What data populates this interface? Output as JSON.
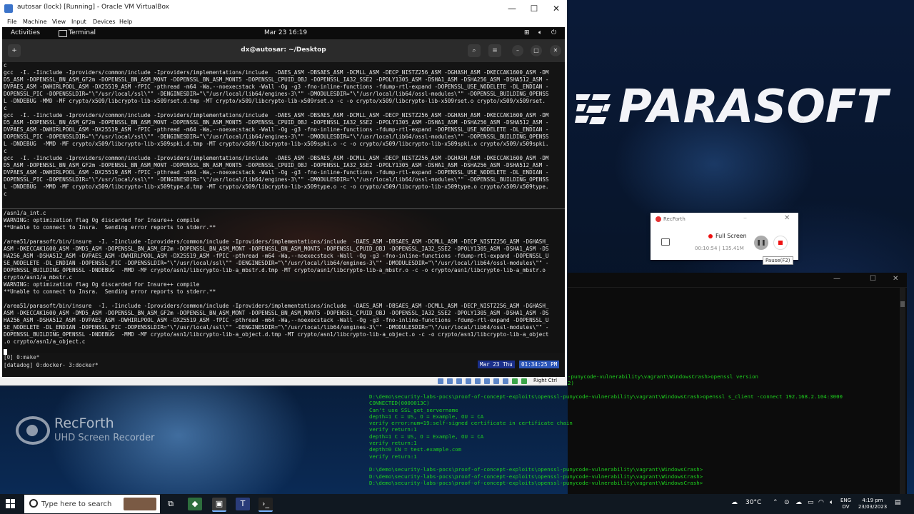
{
  "vbox": {
    "title": "autosar (lock) [Running] - Oracle VM VirtualBox",
    "menu": [
      "File",
      "Machine",
      "View",
      "Input",
      "Devices",
      "Help"
    ],
    "status_right": "Right Ctrl"
  },
  "gnome": {
    "activities": "Activities",
    "app": "Terminal",
    "clock": "Mar 23  16:19"
  },
  "terminal": {
    "title": "dx@autosar: ~/Desktop",
    "top_pane": "c\ngcc  -I. -Iinclude -Iproviders/common/include -Iproviders/implementations/include  -DAES_ASM -DBSAES_ASM -DCMLL_ASM -DECP_NISTZ256_ASM -DGHASH_ASM -DKECCAK1600_ASM -DM\nD5_ASM -DOPENSSL_BN_ASM_GF2m -DOPENSSL_BN_ASM_MONT -DOPENSSL_BN_ASM_MONT5 -DOPENSSL_CPUID_OBJ -DOPENSSL_IA32_SSE2 -DPOLY1305_ASM -DSHA1_ASM -DSHA256_ASM -DSHA512_ASM -\nDVPAES_ASM -DWHIRLPOOL_ASM -DX25519_ASM -fPIC -pthread -m64 -Wa,--noexecstack -Wall -Og -g3 -fno-inline-functions -fdump-rtl-expand -DOPENSSL_USE_NODELETE -DL_ENDIAN -\nDOPENSSL_PIC -DOPENSSLDIR=\"\\\"/usr/local/ssl\\\"\" -DENGINESDIR=\"\\\"/usr/local/lib64/engines-3\\\"\" -DMODULESDIR=\"\\\"/usr/local/lib64/ossl-modules\\\"\" -DOPENSSL_BUILDING_OPENSS\nL -DNDEBUG -MMD -MF crypto/x509/libcrypto-lib-x509rset.d.tmp -MT crypto/x509/libcrypto-lib-x509rset.o -c -o crypto/x509/libcrypto-lib-x509rset.o crypto/x509/x509rset.\nc\ngcc  -I. -Iinclude -Iproviders/common/include -Iproviders/implementations/include  -DAES_ASM -DBSAES_ASM -DCMLL_ASM -DECP_NISTZ256_ASM -DGHASH_ASM -DKECCAK1600_ASM -DM\nD5_ASM -DOPENSSL_BN_ASM_GF2m -DOPENSSL_BN_ASM_MONT -DOPENSSL_BN_ASM_MONT5 -DOPENSSL_CPUID_OBJ -DOPENSSL_IA32_SSE2 -DPOLY1305_ASM -DSHA1_ASM -DSHA256_ASM -DSHA512_ASM -\nDVPAES_ASM -DWHIRLPOOL_ASM -DX25519_ASM -fPIC -pthread -m64 -Wa,--noexecstack -Wall -Og -g3 -fno-inline-functions -fdump-rtl-expand -DOPENSSL_USE_NODELETE -DL_ENDIAN -\nDOPENSSL_PIC -DOPENSSLDIR=\"\\\"/usr/local/ssl\\\"\" -DENGINESDIR=\"\\\"/usr/local/lib64/engines-3\\\"\" -DMODULESDIR=\"\\\"/usr/local/lib64/ossl-modules\\\"\" -DOPENSSL_BUILDING_OPENSS\nL -DNDEBUG  -MMD -MF crypto/x509/libcrypto-lib-x509spki.d.tmp -MT crypto/x509/libcrypto-lib-x509spki.o -c -o crypto/x509/libcrypto-lib-x509spki.o crypto/x509/x509spki.\nc\ngcc  -I. -Iinclude -Iproviders/common/include -Iproviders/implementations/include  -DAES_ASM -DBSAES_ASM -DCMLL_ASM -DECP_NISTZ256_ASM -DGHASH_ASM -DKECCAK1600_ASM -DM\nD5_ASM -DOPENSSL_BN_ASM_GF2m -DOPENSSL_BN_ASM_MONT -DOPENSSL_BN_ASM_MONT5 -DOPENSSL_CPUID_OBJ -DOPENSSL_IA32_SSE2 -DPOLY1305_ASM -DSHA1_ASM -DSHA256_ASM -DSHA512_ASM -\nDVPAES_ASM -DWHIRLPOOL_ASM -DX25519_ASM -fPIC -pthread -m64 -Wa,--noexecstack -Wall -Og -g3 -fno-inline-functions -fdump-rtl-expand -DOPENSSL_USE_NODELETE -DL_ENDIAN -\nDOPENSSL_PIC -DOPENSSLDIR=\"\\\"/usr/local/ssl\\\"\" -DENGINESDIR=\"\\\"/usr/local/lib64/engines-3\\\"\" -DMODULESDIR=\"\\\"/usr/local/lib64/ossl-modules\\\"\" -DOPENSSL_BUILDING_OPENSS\nL -DNDEBUG  -MMD -MF crypto/x509/libcrypto-lib-x509type.d.tmp -MT crypto/x509/libcrypto-lib-x509type.o -c -o crypto/x509/libcrypto-lib-x509type.o crypto/x509/x509type.\nc",
    "bottom_pane": "/asn1/a_int.c\nWARNING: optimization flag Og discarded for Insure++ compile\n**Unable to connect to Insra.  Sending error reports to stderr.**\n\n/area51/parasoft/bin/insure  -I. -Iinclude -Iproviders/common/include -Iproviders/implementations/include  -DAES_ASM -DBSAES_ASM -DCMLL_ASM -DECP_NISTZ256_ASM -DGHASH_\nASM -DKECCAK1600_ASM -DMD5_ASM -DOPENSSL_BN_ASM_GF2m -DOPENSSL_BN_ASM_MONT -DOPENSSL_BN_ASM_MONT5 -DOPENSSL_CPUID_OBJ -DOPENSSL_IA32_SSE2 -DPOLY1305_ASM -DSHA1_ASM -DS\nHA256_ASM -DSHA512_ASM -DVPAES_ASM -DWHIRLPOOL_ASM -DX25519_ASM -fPIC -pthread -m64 -Wa,--noexecstack -Wall -Og -g3 -fno-inline-functions -fdump-rtl-expand -DOPENSSL_U\nSE_NODELETE -DL_ENDIAN -DOPENSSL_PIC -DOPENSSLDIR=\"\\\"/usr/local/ssl\\\"\" -DENGINESDIR=\"\\\"/usr/local/lib64/engines-3\\\"\" -DMODULESDIR=\"\\\"/usr/local/lib64/ossl-modules\\\"\" -\nDOPENSSL_BUILDING_OPENSSL -DNDEBUG  -MMD -MF crypto/asn1/libcrypto-lib-a_mbstr.d.tmp -MT crypto/asn1/libcrypto-lib-a_mbstr.o -c -o crypto/asn1/libcrypto-lib-a_mbstr.o \ncrypto/asn1/a_mbstr.c\nWARNING: optimization flag Og discarded for Insure++ compile\n**Unable to connect to Insra.  Sending error reports to stderr.**\n\n/area51/parasoft/bin/insure  -I. -Iinclude -Iproviders/common/include -Iproviders/implementations/include  -DAES_ASM -DBSAES_ASM -DCMLL_ASM -DECP_NISTZ256_ASM -DGHASH_\nASM -DKECCAK1600_ASM -DMD5_ASM -DOPENSSL_BN_ASM_GF2m -DOPENSSL_BN_ASM_MONT -DOPENSSL_BN_ASM_MONT5 -DOPENSSL_CPUID_OBJ -DOPENSSL_IA32_SSE2 -DPOLY1305_ASM -DSHA1_ASM -DS\nHA256_ASM -DSHA512_ASM -DVPAES_ASM -DWHIRLPOOL_ASM -DX25519_ASM -fPIC -pthread -m64 -Wa,--noexecstack -Wall -Og -g3 -fno-inline-functions -fdump-rtl-expand -DOPENSSL_U\nSE_NODELETE -DL_ENDIAN -DOPENSSL_PIC -DOPENSSLDIR=\"\\\"/usr/local/ssl\\\"\" -DENGINESDIR=\"\\\"/usr/local/lib64/engines-3\\\"\" -DMODULESDIR=\"\\\"/usr/local/lib64/ossl-modules\\\"\" -\nDOPENSSL_BUILDING_OPENSSL -DNDEBUG  -MMD -MF crypto/asn1/libcrypto-lib-a_object.d.tmp -MT crypto/asn1/libcrypto-lib-a_object.o -c -o crypto/asn1/libcrypto-lib-a_object\n.o crypto/asn1/a_object.c",
    "tmux_window": "[0] 0:make*",
    "tmux_session": "[datadog] 0:docker- 3:docker*",
    "tmux_date": "Mar 23 Thu",
    "tmux_time": "01:34:25 PM"
  },
  "brand": {
    "logo_text": "PARASOFT",
    "reg_mark": "®"
  },
  "recforth_widget": {
    "app_name": "RecForth",
    "mode": "Full Screen",
    "elapsed": "00:10:54",
    "size": "135.41M",
    "pause_tooltip": "Pause(F2)"
  },
  "watermark": {
    "title": "RecForth",
    "subtitle": "UHD Screen Recorder"
  },
  "cmd": {
    "partial_top": "-punycode-vulnerability\\vagrant\\WindowsCrash>openssl version\n2)",
    "output": "D:\\demo\\security-labs-pocs\\proof-of-concept-exploits\\openssl-punycode-vulnerability\\vagrant\\WindowsCrash>openssl s_client -connect 192.168.2.104:3000\nCONNECTED(0000013C)\nCan't use SSL_get_servername\ndepth=1 C = US, O = Example, OU = CA\nverify error:num=19:self-signed certificate in certificate chain\nverify return:1\ndepth=1 C = US, O = Example, OU = CA\nverify return:1\ndepth=0 CN = test.example.com\nverify return:1\n\nD:\\demo\\security-labs-pocs\\proof-of-concept-exploits\\openssl-punycode-vulnerability\\vagrant\\WindowsCrash>\nD:\\demo\\security-labs-pocs\\proof-of-concept-exploits\\openssl-punycode-vulnerability\\vagrant\\WindowsCrash>\nD:\\demo\\security-labs-pocs\\proof-of-concept-exploits\\openssl-punycode-vulnerability\\vagrant\\WindowsCrash>"
  },
  "taskbar": {
    "search_placeholder": "Type here to search",
    "temperature": "30°C",
    "lang_line1": "ENG",
    "lang_line2": "DV",
    "time": "4:19 pm",
    "date": "23/03/2023"
  },
  "colors": {
    "terminal_green": "#1ed11e",
    "tmux_date_bg": "#1a2f8a",
    "tmux_time_bg": "#2a55b8",
    "record_red": "#e11111"
  }
}
